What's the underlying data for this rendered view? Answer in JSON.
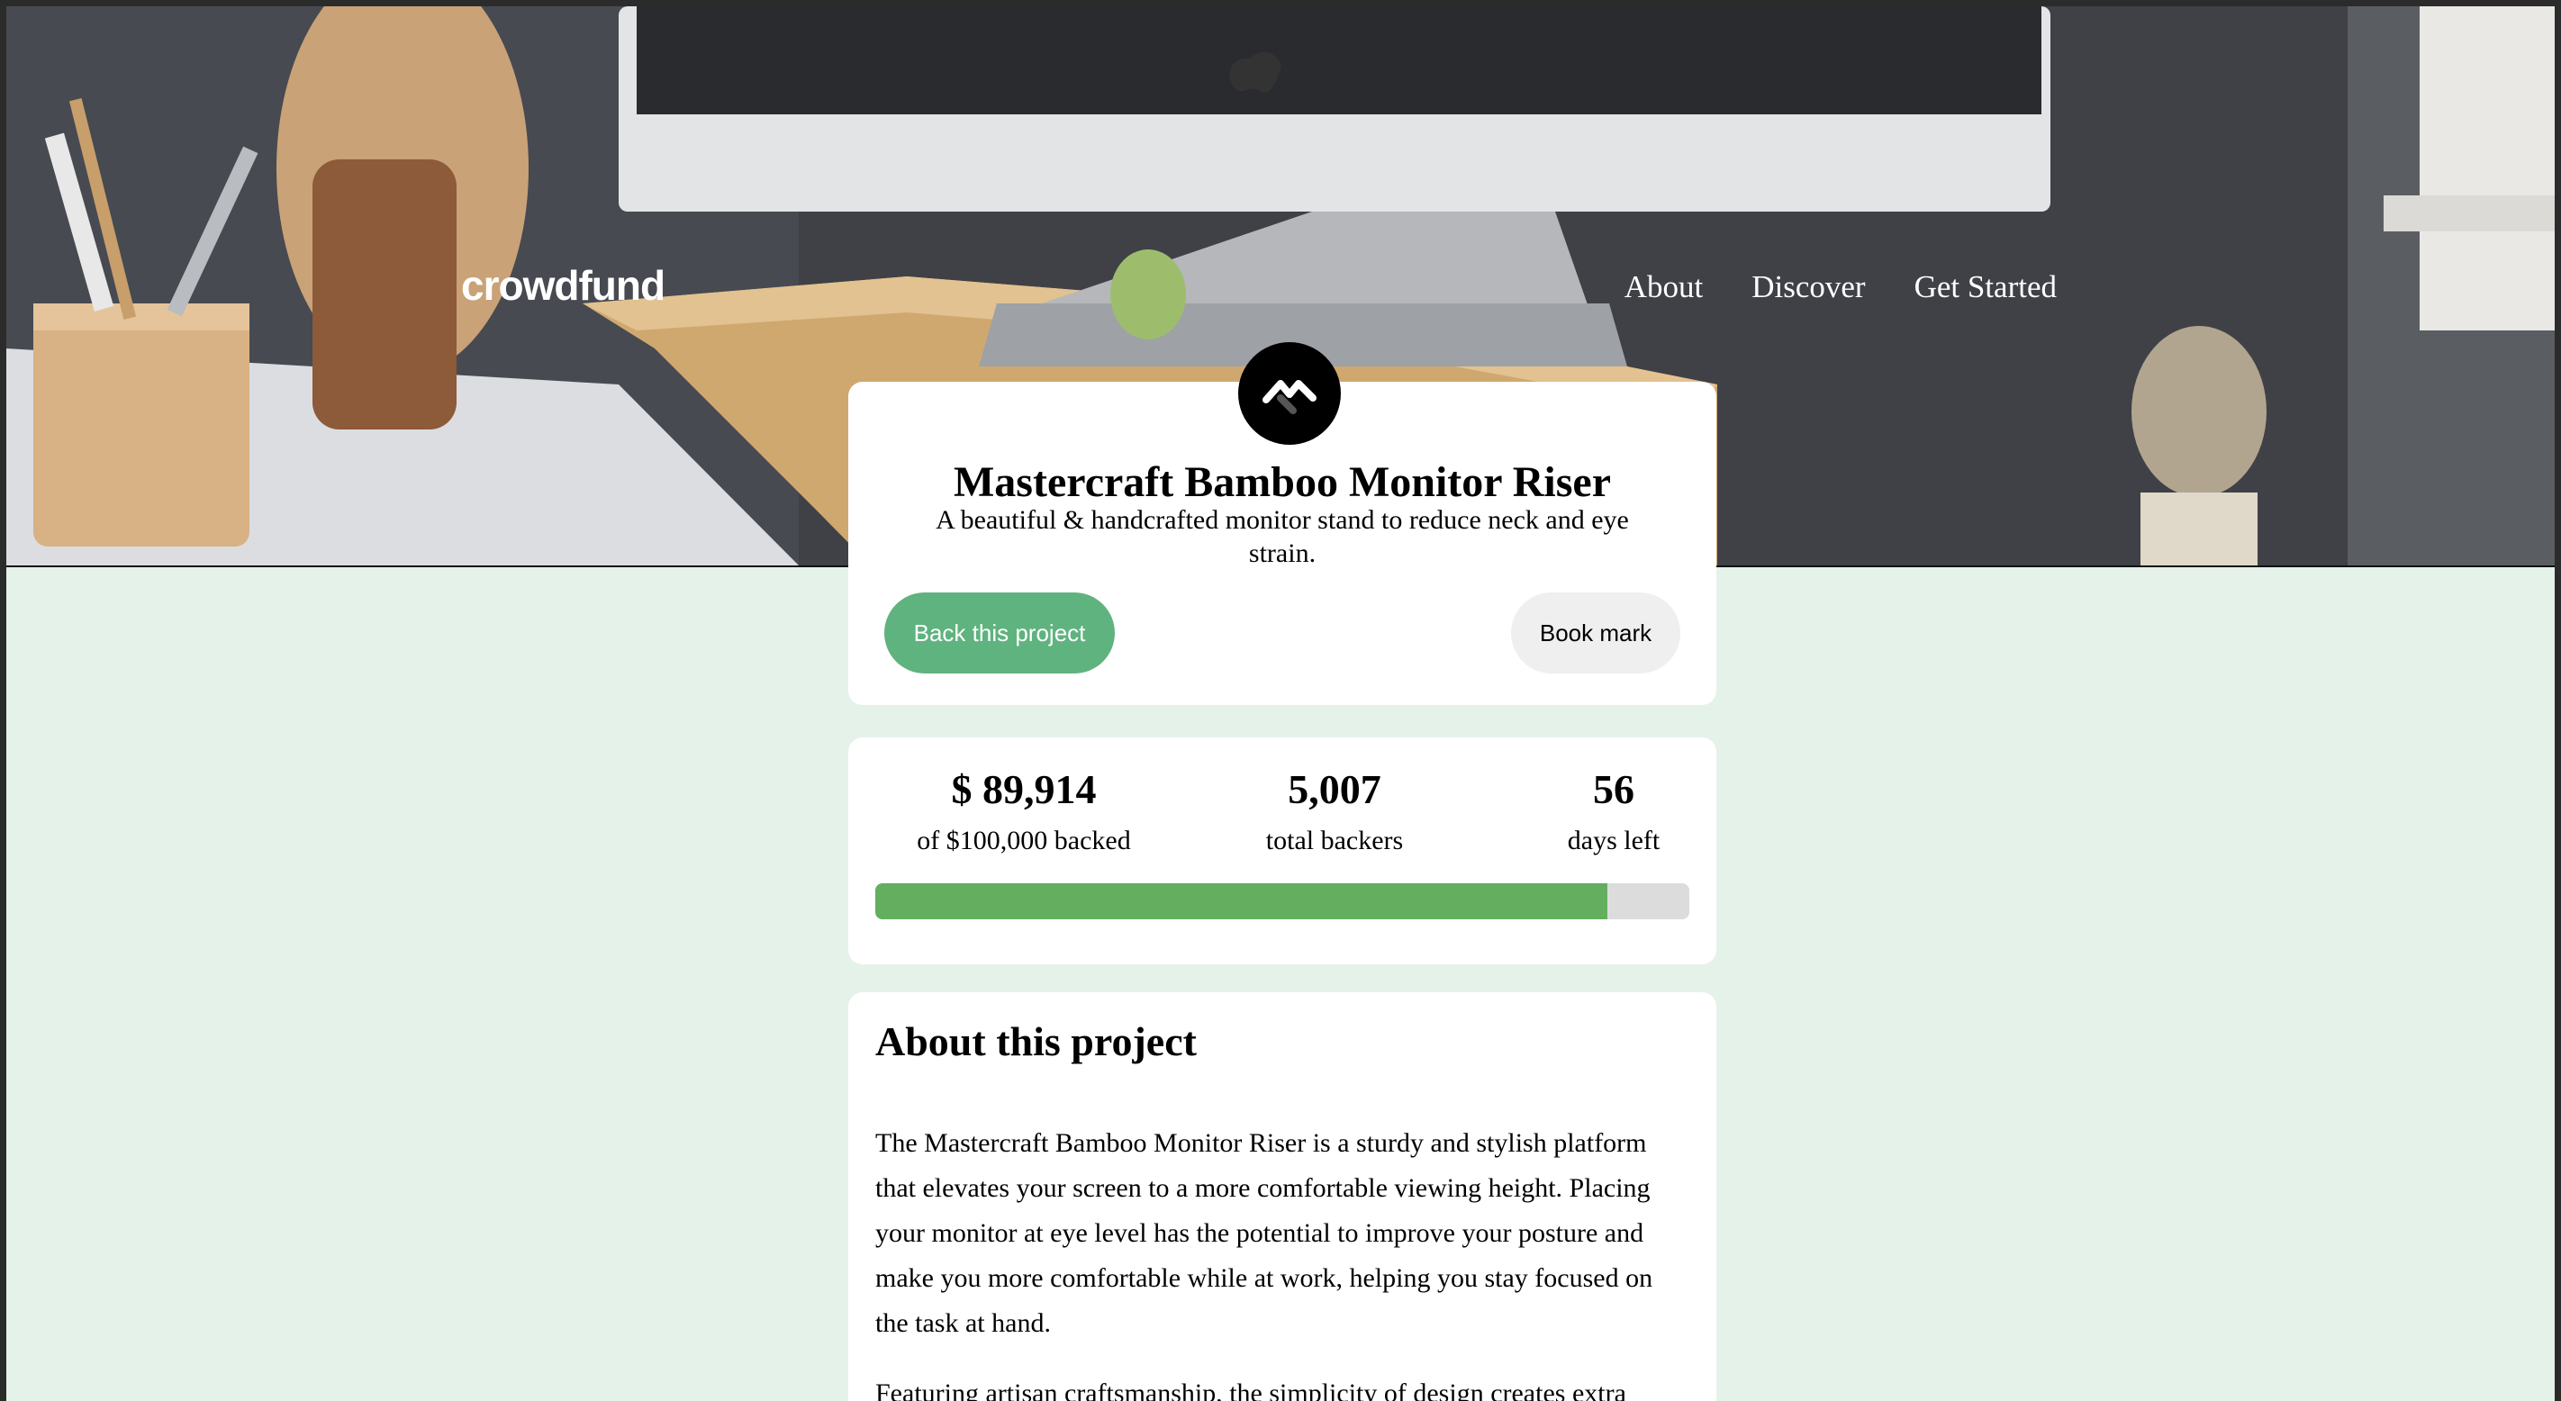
{
  "header": {
    "logo": "crowdfund",
    "nav": [
      "About",
      "Discover",
      "Get Started"
    ]
  },
  "project": {
    "logo_icon": "mastercraft-logo-icon",
    "title": "Mastercraft Bamboo Monitor Riser",
    "tagline": "A beautiful & handcrafted monitor stand to reduce neck and eye strain.",
    "back_button": "Back this project",
    "bookmark_button": "Book mark"
  },
  "stats": {
    "backed_amount": "$ 89,914",
    "backed_label": "of $100,000 backed",
    "backers": "5,007",
    "backers_label": "total backers",
    "days": "56",
    "days_label": "days left",
    "progress_fraction": 0.89914
  },
  "about": {
    "heading": "About this project",
    "paragraph1": "The Mastercraft Bamboo Monitor Riser is a sturdy and stylish platform that elevates your screen to a more comfortable viewing height. Placing your monitor at eye level has the potential to improve your posture and make you more comfortable while at work, helping you stay focused on the task at hand.",
    "paragraph2": "Featuring artisan craftsmanship, the simplicity of design creates extra"
  },
  "colors": {
    "page_background": "#e5f2e9",
    "accent": "#5fb37e",
    "progress_fill": "#64ae5f",
    "progress_track": "#dcdcdc"
  }
}
